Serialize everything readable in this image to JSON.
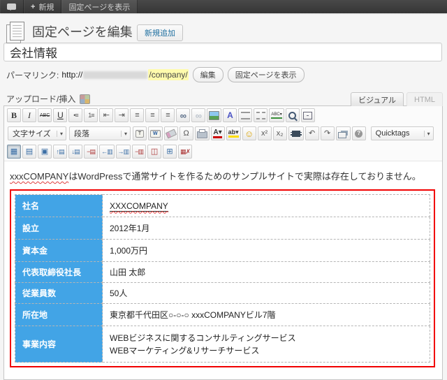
{
  "admin_bar": {
    "plus": "+",
    "new_label": "新規",
    "view_label": "固定ページを表示"
  },
  "header": {
    "title": "固定ページを編集",
    "add_new": "新規追加"
  },
  "title_field": {
    "value": "会社情報"
  },
  "permalink": {
    "label": "パーマリンク:",
    "url_prefix": "http://",
    "slug": "/company/",
    "edit_button": "編集",
    "view_button": "固定ページを表示"
  },
  "upload": {
    "label": "アップロード/挿入"
  },
  "editor_tabs": {
    "visual": "ビジュアル",
    "html": "HTML"
  },
  "toolbar": {
    "caret": "▾",
    "font_size_label": "文字サイズ",
    "format_label": "段落",
    "quicktags_label": "Quicktags",
    "row1": [
      {
        "name": "bold-button",
        "icon": "bold-icon",
        "glyph": "B",
        "cls": "g ic-b"
      },
      {
        "name": "italic-button",
        "icon": "italic-icon",
        "glyph": "I",
        "cls": "g ic-i"
      },
      {
        "name": "strikethrough-button",
        "icon": "strikethrough-icon",
        "glyph": "ABC",
        "cls": "g ic-abc"
      },
      {
        "name": "underline-button",
        "icon": "underline-icon",
        "glyph": "U",
        "cls": "g ic-u"
      },
      {
        "name": "bullet-list-button",
        "icon": "bullet-list-icon",
        "glyph": "•≡",
        "cls": "g sm"
      },
      {
        "name": "numbered-list-button",
        "icon": "numbered-list-icon",
        "glyph": "1≡",
        "cls": "g sm"
      },
      {
        "name": "outdent-button",
        "icon": "outdent-icon",
        "glyph": "⇤",
        "cls": "g"
      },
      {
        "name": "indent-button",
        "icon": "indent-icon",
        "glyph": "⇥",
        "cls": "g"
      },
      {
        "name": "align-left-button",
        "icon": "align-left-icon",
        "glyph": "≡",
        "cls": "g"
      },
      {
        "name": "align-center-button",
        "icon": "align-center-icon",
        "glyph": "≡",
        "cls": "g"
      },
      {
        "name": "align-right-button",
        "icon": "align-right-icon",
        "glyph": "≡",
        "cls": "g"
      },
      {
        "name": "link-button",
        "icon": "link-icon",
        "glyph": "∞",
        "cls": "g ic-link"
      },
      {
        "name": "unlink-button",
        "icon": "unlink-icon",
        "glyph": "∞",
        "cls": "g ic-unlink"
      },
      {
        "name": "insert-image-button",
        "icon": "image-icon",
        "glyph": "",
        "cls": "g ic-img"
      },
      {
        "name": "text-style-button",
        "icon": "colored-a-icon",
        "glyph": "A",
        "cls": "g ic-colA"
      },
      {
        "name": "more-tag-button",
        "icon": "more-tag-icon",
        "glyph": "",
        "cls": "g ic-split"
      },
      {
        "name": "page-break-button",
        "icon": "page-break-icon",
        "glyph": "",
        "cls": "g ic-split dashed"
      },
      {
        "name": "spellcheck-button",
        "icon": "spellcheck-icon",
        "glyph": "ABC▾",
        "cls": "g ic-spell"
      },
      {
        "name": "search-button",
        "icon": "search-icon",
        "glyph": "",
        "cls": "g ic-search"
      },
      {
        "name": "fullscreen-button",
        "icon": "fullscreen-icon",
        "glyph": "",
        "cls": "g ic-fs"
      }
    ],
    "row2": [
      {
        "name": "paste-text-button",
        "icon": "paste-text-icon",
        "glyph": "T",
        "cls": "g ic-clip"
      },
      {
        "name": "paste-word-button",
        "icon": "paste-word-icon",
        "glyph": "W",
        "cls": "g ic-clip word"
      },
      {
        "name": "remove-format-button",
        "icon": "eraser-icon",
        "glyph": "",
        "cls": "g ic-eraser"
      },
      {
        "name": "special-char-button",
        "icon": "omega-icon",
        "glyph": "Ω",
        "cls": "g"
      },
      {
        "name": "print-button",
        "icon": "print-icon",
        "glyph": "",
        "cls": "g ic-print"
      },
      {
        "name": "text-color-button",
        "icon": "text-color-icon",
        "glyph": "A▾",
        "cls": "g ic-fontcolor"
      },
      {
        "name": "highlight-color-button",
        "icon": "highlight-icon",
        "glyph": "ab▾",
        "cls": "g ic-highlight"
      },
      {
        "name": "emoticon-button",
        "icon": "smiley-icon",
        "glyph": "☺",
        "cls": "g ic-smile"
      },
      {
        "name": "superscript-button",
        "icon": "superscript-icon",
        "glyph": "x²",
        "cls": "g"
      },
      {
        "name": "subscript-button",
        "icon": "subscript-icon",
        "glyph": "x₂",
        "cls": "g"
      },
      {
        "name": "insert-media-button",
        "icon": "film-icon",
        "glyph": "",
        "cls": "g ic-film"
      },
      {
        "name": "undo-button",
        "icon": "undo-icon",
        "glyph": "↶",
        "cls": "g"
      },
      {
        "name": "redo-button",
        "icon": "redo-icon",
        "glyph": "↷",
        "cls": "g"
      },
      {
        "name": "popup-window-button",
        "icon": "popup-window-icon",
        "glyph": "",
        "cls": "g ic-popup"
      },
      {
        "name": "help-button",
        "icon": "help-icon",
        "glyph": "?",
        "cls": "g ic-help"
      }
    ],
    "row3": [
      {
        "name": "insert-table-button",
        "icon": "table-icon",
        "glyph": "▦",
        "cls": "g c-tbl"
      },
      {
        "name": "table-row-props-button",
        "icon": "row-props-icon",
        "glyph": "▤",
        "cls": "g c-tbl"
      },
      {
        "name": "table-cell-props-button",
        "icon": "cell-props-icon",
        "glyph": "▣",
        "cls": "g c-tbl"
      },
      {
        "name": "insert-row-before-button",
        "icon": "row-before-icon",
        "glyph": "↑▤",
        "cls": "g c-tbl sm"
      },
      {
        "name": "insert-row-after-button",
        "icon": "row-after-icon",
        "glyph": "↓▤",
        "cls": "g c-tbl sm"
      },
      {
        "name": "delete-row-button",
        "icon": "delete-row-icon",
        "glyph": "−▤",
        "cls": "g c-del sm"
      },
      {
        "name": "insert-col-before-button",
        "icon": "col-before-icon",
        "glyph": "←▥",
        "cls": "g c-tbl sm"
      },
      {
        "name": "insert-col-after-button",
        "icon": "col-after-icon",
        "glyph": "→▥",
        "cls": "g c-tbl sm"
      },
      {
        "name": "delete-col-button",
        "icon": "delete-col-icon",
        "glyph": "−▥",
        "cls": "g c-del sm"
      },
      {
        "name": "split-cells-button",
        "icon": "split-cells-icon",
        "glyph": "◫",
        "cls": "g c-del"
      },
      {
        "name": "merge-cells-button",
        "icon": "merge-cells-icon",
        "glyph": "⊞",
        "cls": "g c-tbl"
      },
      {
        "name": "delete-table-button",
        "icon": "delete-table-icon",
        "glyph": "▦✗",
        "cls": "g c-del sm"
      }
    ]
  },
  "content": {
    "paragraph_misspelled": "xxxCOMPANY",
    "paragraph_rest": "はWordPressで通常サイトを作るためのサンプルサイトで実際は存在しておりません。",
    "company_table": {
      "rows": [
        {
          "label": "社名",
          "value": "XXXCOMPANY",
          "valcls": "val misspelled-link"
        },
        {
          "label": "設立",
          "value": "2012年1月",
          "valcls": "val"
        },
        {
          "label": "資本金",
          "value": "1,000万円",
          "valcls": "val"
        },
        {
          "label": "代表取締役社長",
          "value": "山田 太郎",
          "valcls": "val"
        },
        {
          "label": "従業員数",
          "value": "50人",
          "valcls": "val"
        },
        {
          "label": "所在地",
          "value": "東京都千代田区○-○-○ xxxCOMPANYビル7階",
          "valcls": "val"
        },
        {
          "label": "事業内容",
          "value": "WEBビジネスに関するコンサルティングサービス\nWEBマーケティング&リサーチサービス",
          "valcls": "val multiline"
        }
      ]
    }
  },
  "colors": {
    "accent_blue": "#42a4e6",
    "selection_red": "#f10000",
    "highlight_yellow": "#fffbad",
    "admin_bar": "#464646"
  }
}
